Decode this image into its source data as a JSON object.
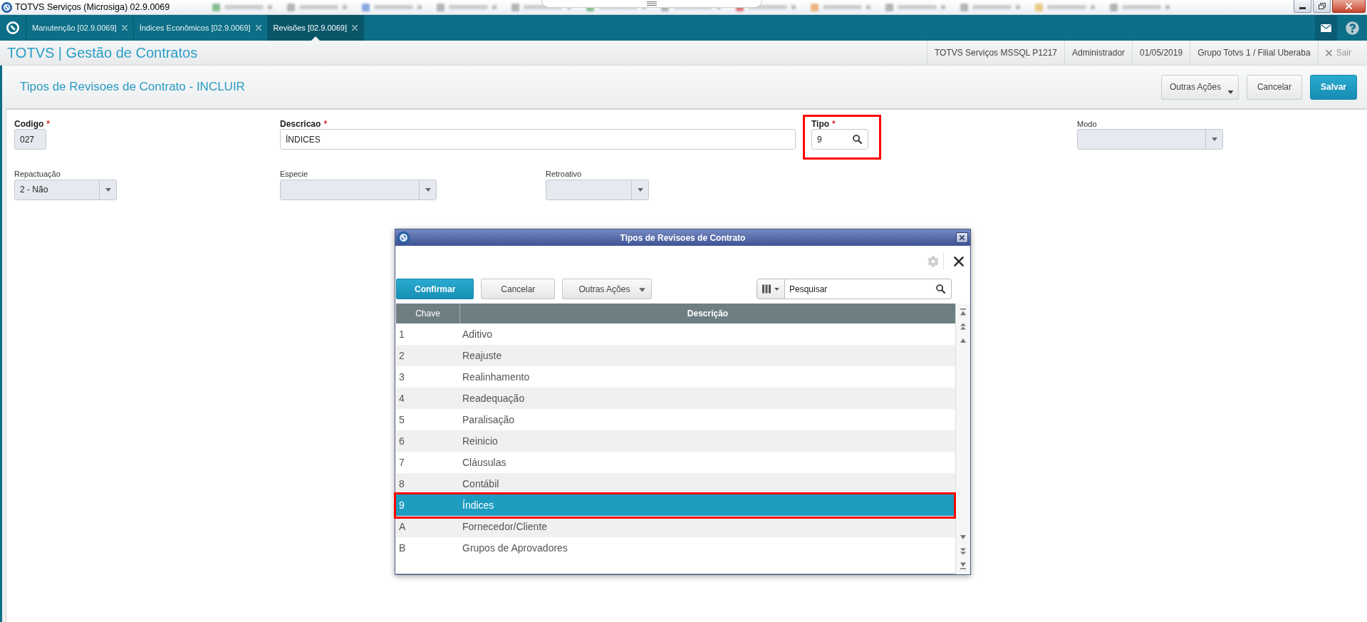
{
  "window": {
    "title": "TOTVS Serviços (Microsiga) 02.9.0069"
  },
  "app_tabs": [
    {
      "label": "Manutenção [02.9.0069]",
      "selected": false
    },
    {
      "label": "Índices Econômicos [02.9.0069]",
      "selected": false
    },
    {
      "label": "Revisões [02.9.0069]",
      "selected": true
    }
  ],
  "header": {
    "title": "TOTVS | Gestão de Contratos",
    "info": [
      "TOTVS Serviços MSSQL P1217",
      "Administrador",
      "01/05/2019",
      "Grupo Totvs 1 / Filial Uberaba"
    ],
    "logout": "Sair"
  },
  "page": {
    "title": "Tipos de Revisoes de Contrato - INCLUIR",
    "buttons": [
      {
        "label": "Outras Ações",
        "kind": "menu"
      },
      {
        "label": "Cancelar",
        "kind": "default"
      },
      {
        "label": "Salvar",
        "kind": "primary"
      }
    ]
  },
  "form": {
    "rows": [
      [
        {
          "label": "Codigo",
          "required_mark": "*",
          "kind": "text",
          "value": "027",
          "disabled": true,
          "annotated": false
        },
        {
          "label": "Descricao",
          "required_mark": "*",
          "kind": "text",
          "value": "ÍNDICES",
          "disabled": false,
          "annotated": false
        },
        {
          "label": "Tipo",
          "required_mark": "*",
          "kind": "lookup",
          "value": "9",
          "disabled": false,
          "annotated": true
        },
        {
          "label": "Modo",
          "kind": "select",
          "disabled": true,
          "annotated": false
        }
      ],
      [
        {
          "label": "Repactuação",
          "kind": "select",
          "value": "2 - Não",
          "disabled": true,
          "annotated": false
        },
        {
          "label": "Especie",
          "kind": "select",
          "disabled": true,
          "annotated": false
        },
        {
          "label": "Retroativo",
          "kind": "select",
          "disabled": true,
          "annotated": false
        }
      ]
    ]
  },
  "dialog": {
    "title": "Tipos de Revisoes de Contrato",
    "buttons": [
      {
        "label": "Confirmar",
        "kind": "primary"
      },
      {
        "label": "Cancelar",
        "kind": "default"
      },
      {
        "label": "Outras Ações",
        "kind": "menu"
      }
    ],
    "search": {
      "placeholder": "Pesquisar"
    },
    "table": {
      "columns": [
        {
          "label": "Chave",
          "sorted": false
        },
        {
          "label": "Descrição",
          "sorted": true
        }
      ],
      "rows": [
        {
          "key": "1",
          "description": "Aditivo",
          "selected": false,
          "annotated": false
        },
        {
          "key": "2",
          "description": "Reajuste",
          "selected": false,
          "annotated": false
        },
        {
          "key": "3",
          "description": "Realinhamento",
          "selected": false,
          "annotated": false
        },
        {
          "key": "4",
          "description": "Readequação",
          "selected": false,
          "annotated": false
        },
        {
          "key": "5",
          "description": "Paralisação",
          "selected": false,
          "annotated": false
        },
        {
          "key": "6",
          "description": "Reinicio",
          "selected": false,
          "annotated": false
        },
        {
          "key": "7",
          "description": "Cláusulas",
          "selected": false,
          "annotated": false
        },
        {
          "key": "8",
          "description": "Contábil",
          "selected": false,
          "annotated": false
        },
        {
          "key": "9",
          "description": "Índices",
          "selected": true,
          "annotated": true
        },
        {
          "key": "A",
          "description": "Fornecedor/Cliente",
          "selected": false,
          "annotated": false
        },
        {
          "key": "B",
          "description": "Grupos de Aprovadores",
          "selected": false,
          "annotated": false
        }
      ]
    }
  }
}
